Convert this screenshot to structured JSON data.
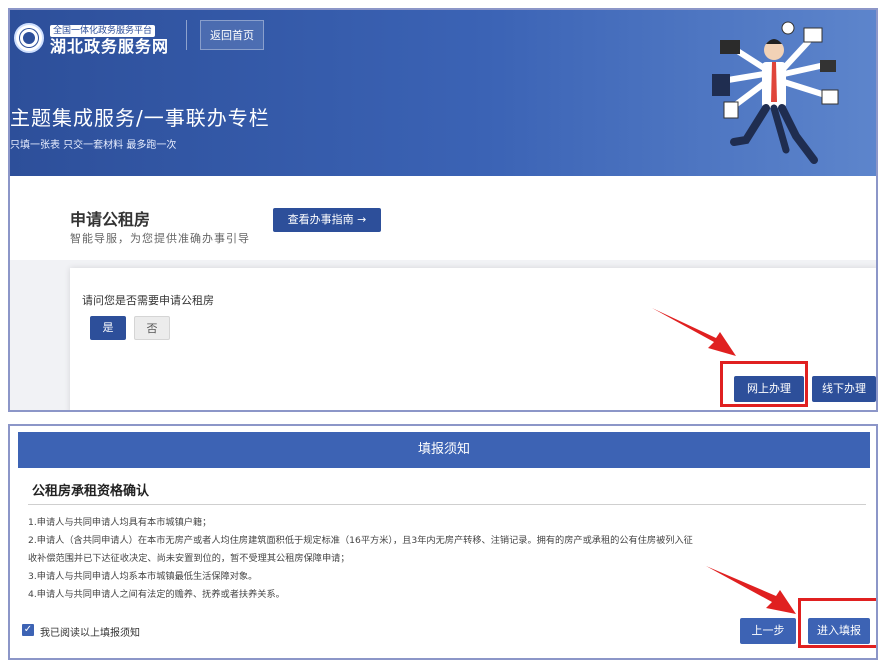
{
  "header": {
    "logo_small": "全国一体化政务服务平台",
    "logo_big": "湖北政务服务网",
    "home_button": "返回首页"
  },
  "banner": {
    "title": "主题集成服务/一事联办专栏",
    "subtitle": "只填一张表 只交一套材料 最多跑一次"
  },
  "service": {
    "title": "申请公租房",
    "subtitle": "智能导服，为您提供准确办事引导",
    "guide_button": "查看办事指南 →"
  },
  "question": {
    "text": "请问您是否需要申请公租房",
    "yes": "是",
    "no": "否",
    "online": "网上办理",
    "offline": "线下办理"
  },
  "notice": {
    "header": "填报须知",
    "title": "公租房承租资格确认",
    "rules": [
      "1.申请人与共同申请人均具有本市城镇户籍；",
      "2.申请人（含共同申请人）在本市无房产或者人均住房建筑面积低于规定标准（16平方米），且3年内无房产转移、注销记录。拥有的房产或承租的公有住房被列入征",
      "收补偿范围并已下达征收决定、尚未安置到位的，暂不受理其公租房保障申请；",
      "3.申请人与共同申请人均系本市城镇最低生活保障对象。",
      "4.申请人与共同申请人之间有法定的赡养、抚养或者扶养关系。"
    ],
    "agree_label": "我已阅读以上填报须知",
    "prev_button": "上一步",
    "next_button": "进入填报"
  },
  "colors": {
    "primary": "#2d4f9a",
    "highlight": "#e02020"
  }
}
